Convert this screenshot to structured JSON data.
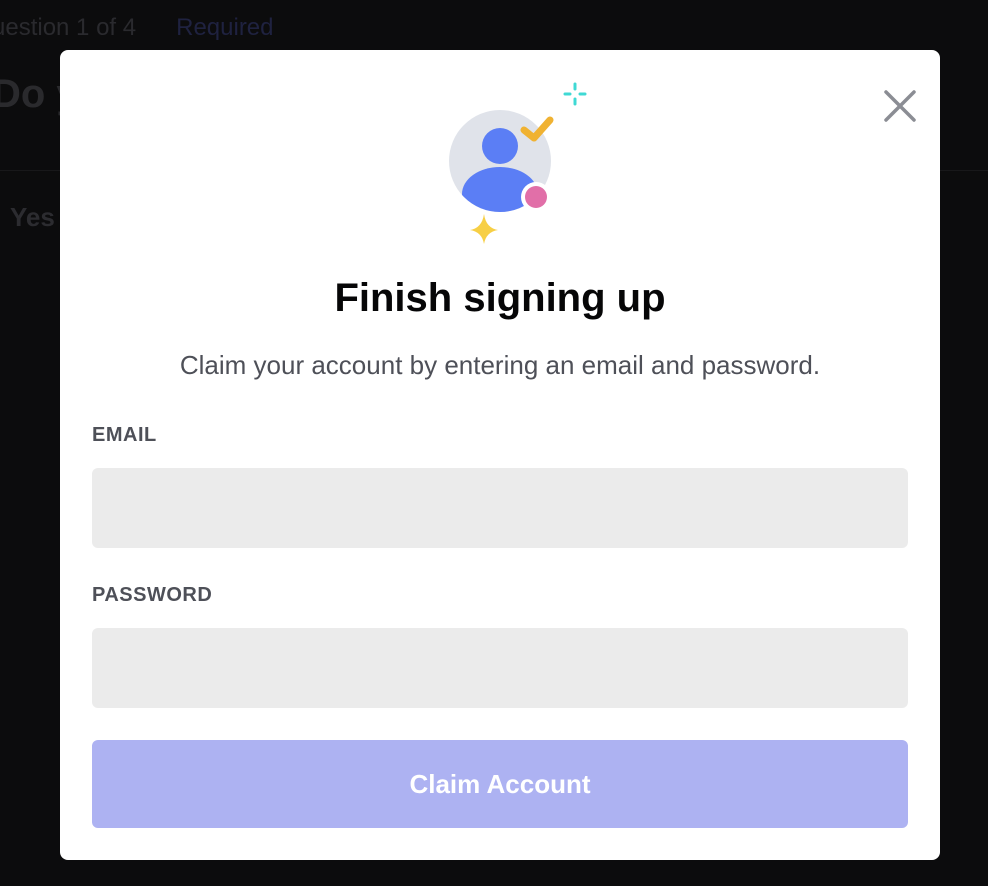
{
  "background": {
    "question_counter": "uestion 1 of 4",
    "required_label": "Required",
    "question_text": "Do y",
    "option_label": "Yes"
  },
  "modal": {
    "title": "Finish signing up",
    "subtitle": "Claim your account by entering an email and password.",
    "email_label": "EMAIL",
    "email_value": "",
    "password_label": "PASSWORD",
    "password_value": "",
    "claim_button_label": "Claim Account",
    "close_icon": "close-icon",
    "illustration_icon": "avatar-check-icon"
  },
  "colors": {
    "button_bg": "#adb2f2",
    "input_bg": "#ebebeb",
    "avatar_blue": "#5b7ef5",
    "check_yellow": "#f0b232",
    "status_pink": "#e16fa8",
    "sparkle_teal": "#3fd9d4",
    "sparkle_yellow": "#f7cf45"
  }
}
